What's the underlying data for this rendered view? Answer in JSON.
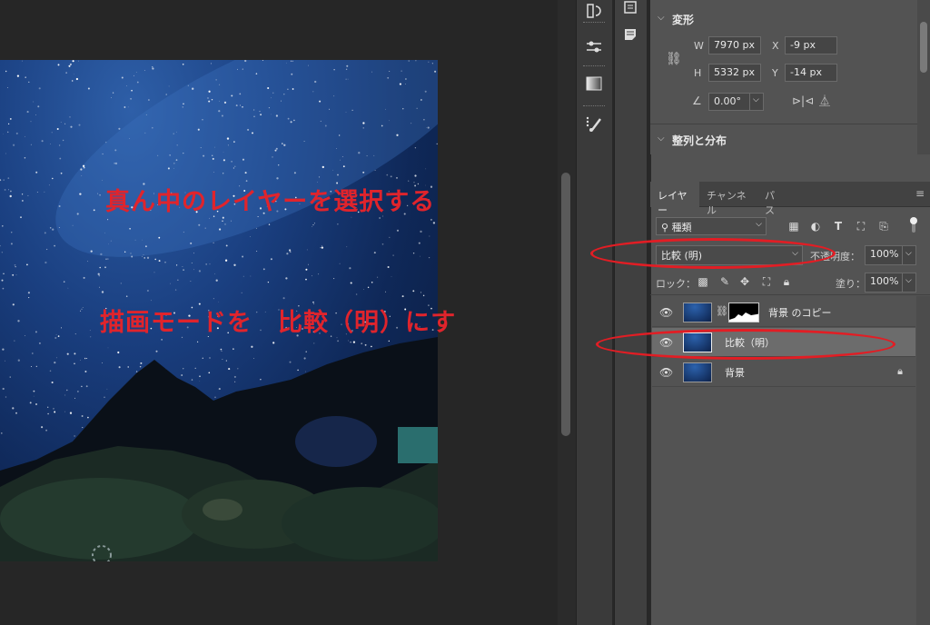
{
  "annotations": {
    "line1": "真ん中のレイヤーを選択する",
    "line2": "描画モードを　比較（明）にす"
  },
  "properties": {
    "transform_title": "変形",
    "w_label": "W",
    "w_value": "7970 px",
    "h_label": "H",
    "h_value": "5332 px",
    "x_label": "X",
    "x_value": "-9 px",
    "y_label": "Y",
    "y_value": "-14 px",
    "angle_value": "0.00°",
    "align_title": "整列と分布"
  },
  "layers_panel": {
    "tabs": [
      "レイヤー",
      "チャンネル",
      "パス"
    ],
    "filter_label": "種類",
    "blend_mode": "比較 (明)",
    "opacity_label": "不透明度：",
    "opacity_value": "100%",
    "lock_label": "ロック：",
    "fill_label": "塗り：",
    "fill_value": "100%",
    "layers": [
      {
        "name": "背景 のコピー"
      },
      {
        "name": "比較（明）"
      },
      {
        "name": "背景"
      }
    ]
  },
  "colors": {
    "annotation": "#e0242c",
    "panel_bg": "#535353",
    "selected_row": "#6c6c6c"
  }
}
